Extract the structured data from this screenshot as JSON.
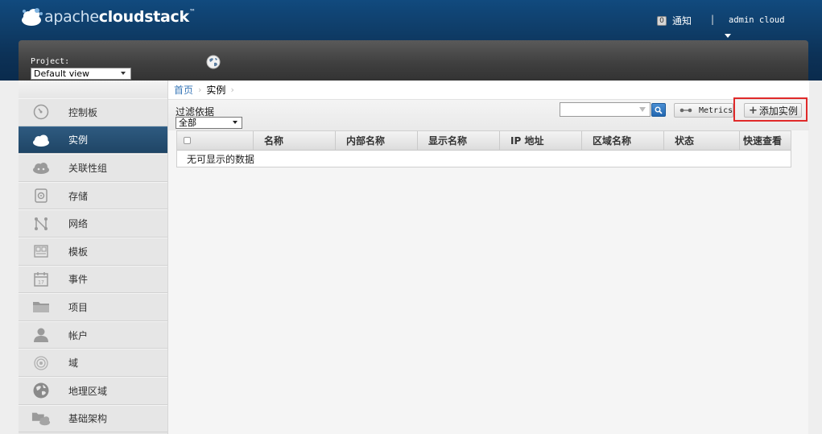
{
  "header": {
    "logo_text_1": "apache",
    "logo_text_2": "cloudstack",
    "logo_tm": "™",
    "notifications_count": "0",
    "notifications_label": "通知",
    "separator": "|",
    "user_label": "admin cloud"
  },
  "project": {
    "label": "Project:",
    "selected": "Default view"
  },
  "sidebar": {
    "items": [
      {
        "label": "控制板",
        "icon": "dashboard-icon"
      },
      {
        "label": "实例",
        "icon": "instances-cloud-icon",
        "active": true
      },
      {
        "label": "关联性组",
        "icon": "affinity-group-icon"
      },
      {
        "label": "存储",
        "icon": "storage-icon"
      },
      {
        "label": "网络",
        "icon": "network-icon"
      },
      {
        "label": "模板",
        "icon": "templates-icon"
      },
      {
        "label": "事件",
        "icon": "events-icon"
      },
      {
        "label": "项目",
        "icon": "projects-icon"
      },
      {
        "label": "帐户",
        "icon": "accounts-icon"
      },
      {
        "label": "域",
        "icon": "domains-icon"
      },
      {
        "label": "地理区域",
        "icon": "regions-icon"
      },
      {
        "label": "基础架构",
        "icon": "infrastructure-icon"
      }
    ]
  },
  "breadcrumb": {
    "home": "首页",
    "current": "实例"
  },
  "toolbar": {
    "filter_label": "过滤依据",
    "filter_selected": "全部",
    "search_placeholder": "",
    "metrics_label": "Metrics",
    "add_label": "添加实例"
  },
  "grid": {
    "columns": [
      "名称",
      "内部名称",
      "显示名称",
      "IP 地址",
      "区域名称",
      "状态",
      "快速查看"
    ],
    "empty_text": "无可显示的数据"
  },
  "colors": {
    "header_bg": "#0c3156",
    "active_nav": "#2e5a80",
    "highlight": "#e02a2a",
    "link": "#3a78b8"
  }
}
